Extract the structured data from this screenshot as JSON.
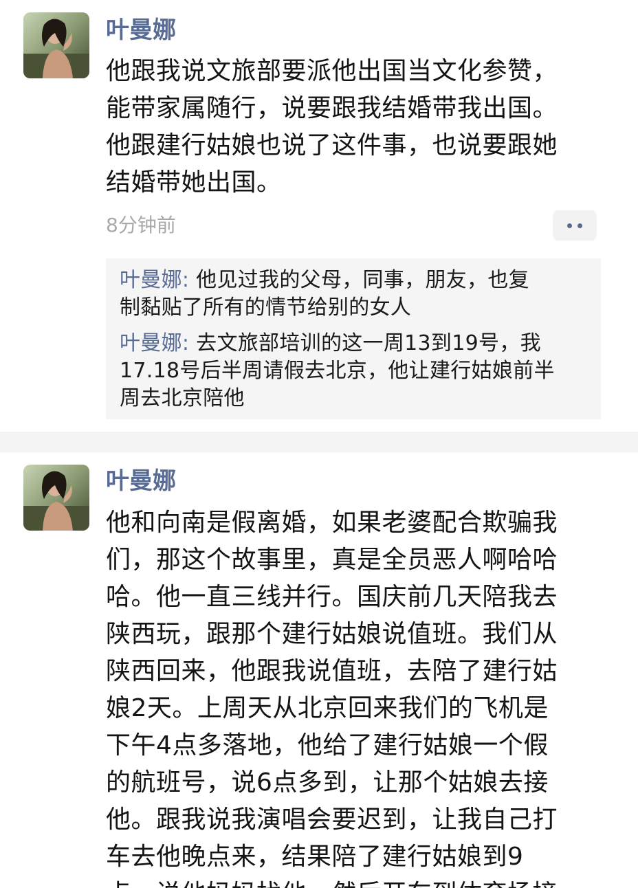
{
  "posts": [
    {
      "username": "叶曼娜",
      "lines": [
        "他跟我说文旅部要派他出国当文化参赞，",
        "能带家属随行，说要跟我结婚带我出国。",
        "他跟建行姑娘也说了这件事，也说要跟她",
        "结婚带她出国。"
      ],
      "timestamp": "8分钟前",
      "more_icon": "more-dots-icon",
      "comments": [
        {
          "author": "叶曼娜",
          "separator": ": ",
          "first_line": "他见过我的父母，同事，朋友，也复",
          "rest_lines": [
            "制黏贴了所有的情节给别的女人"
          ]
        },
        {
          "author": "叶曼娜",
          "separator": ": ",
          "first_line": "去文旅部培训的这一周13到19号，我",
          "rest_lines": [
            "17.18号后半周请假去北京，他让建行姑娘前半",
            "周去北京陪他"
          ]
        }
      ]
    },
    {
      "username": "叶曼娜",
      "lines": [
        "他和向南是假离婚，如果老婆配合欺骗我",
        "们，那这个故事里，真是全员恶人啊哈哈",
        "哈。他一直三线并行。国庆前几天陪我去",
        "陕西玩，跟那个建行姑娘说值班。我们从",
        "陕西回来，他跟我说值班，去陪了建行姑",
        "娘2天。上周天从北京回来我们的飞机是",
        "下午4点多落地，他给了建行姑娘一个假",
        "的航班号，说6点多到，让那个姑娘去接",
        "他。跟我说我演唱会要迟到，让我自己打",
        "车去他晚点来，结果陪了建行姑娘到9",
        "点，说他妈妈找他，然后开车到体育场接"
      ]
    }
  ],
  "colors": {
    "username": "#586b94",
    "body_text": "#141414",
    "timestamp": "#a8a8a8",
    "comment_bg": "#f5f5f5",
    "separator_bg": "#f3f3f3"
  }
}
